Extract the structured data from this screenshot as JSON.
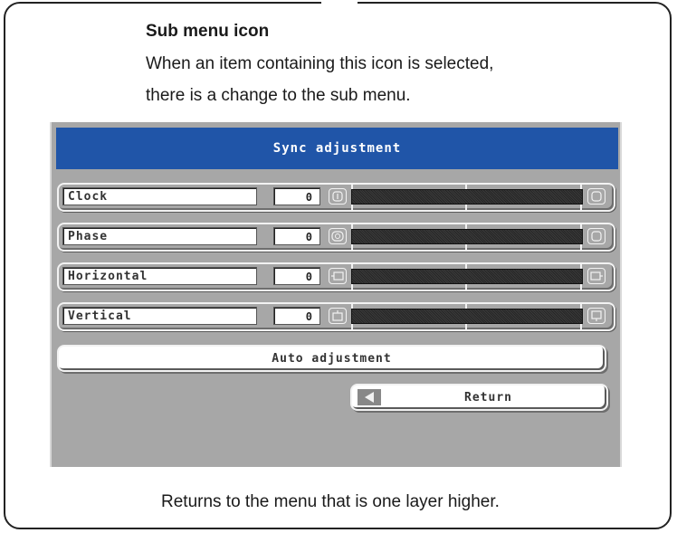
{
  "doc": {
    "title": "Sub menu icon",
    "line1": "When an item containing this icon is selected,",
    "line2": "there is a change to the sub menu.",
    "footer": "Returns to the menu that is one layer higher."
  },
  "osd": {
    "title": "Sync adjustment",
    "rows": [
      {
        "label": "Clock",
        "value": "0",
        "icon": "clock-wave-icon"
      },
      {
        "label": "Phase",
        "value": "0",
        "icon": "phase-wave-icon"
      },
      {
        "label": "Horizontal",
        "value": "0",
        "icon": "horizontal-position-icon"
      },
      {
        "label": "Vertical",
        "value": "0",
        "icon": "vertical-position-icon"
      }
    ],
    "auto_label": "Auto adjustment",
    "return_label": "Return",
    "colors": {
      "header": "#2055a8",
      "panel": "#a7a7a7"
    }
  }
}
